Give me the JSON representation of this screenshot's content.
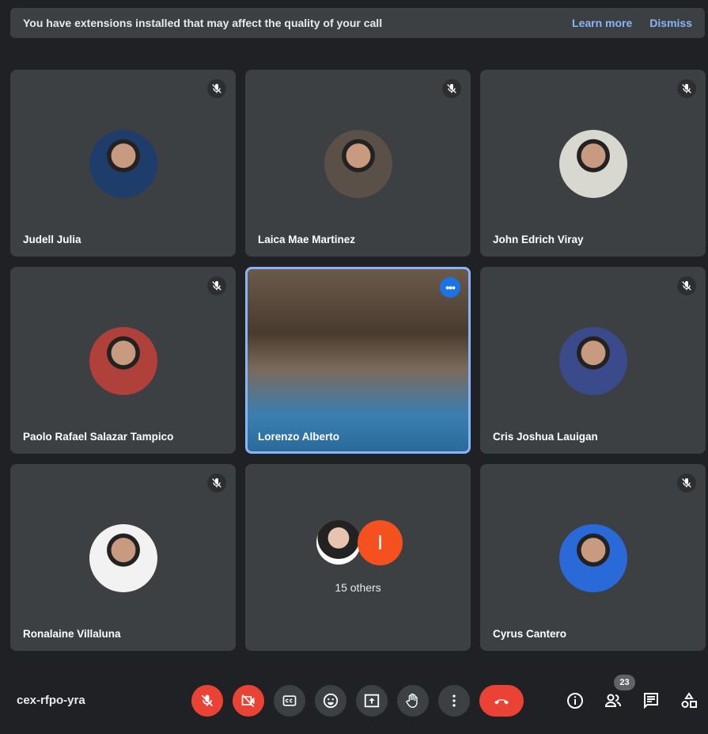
{
  "banner": {
    "message": "You have extensions installed that may affect the quality of your call",
    "learn_more": "Learn more",
    "dismiss": "Dismiss"
  },
  "tiles": [
    {
      "name": "Judell Julia",
      "muted": true,
      "avatar_color": "#1f3d6b"
    },
    {
      "name": "Laica Mae Martinez",
      "muted": true,
      "avatar_color": "#5a5048"
    },
    {
      "name": "John Edrich Viray",
      "muted": true,
      "avatar_color": "#d8d8d0"
    },
    {
      "name": "Paolo Rafael Salazar Tampico",
      "muted": true,
      "avatar_color": "#b0403a"
    },
    {
      "name": "Lorenzo Alberto",
      "muted": false,
      "video": true
    },
    {
      "name": "Cris Joshua Lauigan",
      "muted": true,
      "avatar_color": "#3a4a8a"
    },
    {
      "name": "Ronalaine Villaluna",
      "muted": true,
      "avatar_color": "#f2f2f2"
    },
    {
      "others": true,
      "label": "15 others",
      "initial": "I"
    },
    {
      "name": "Cyrus Cantero",
      "muted": true,
      "avatar_color": "#2a6ad8"
    }
  ],
  "bottom_bar": {
    "meeting_code": "cex-rfpo-yra",
    "participant_count": "23"
  }
}
